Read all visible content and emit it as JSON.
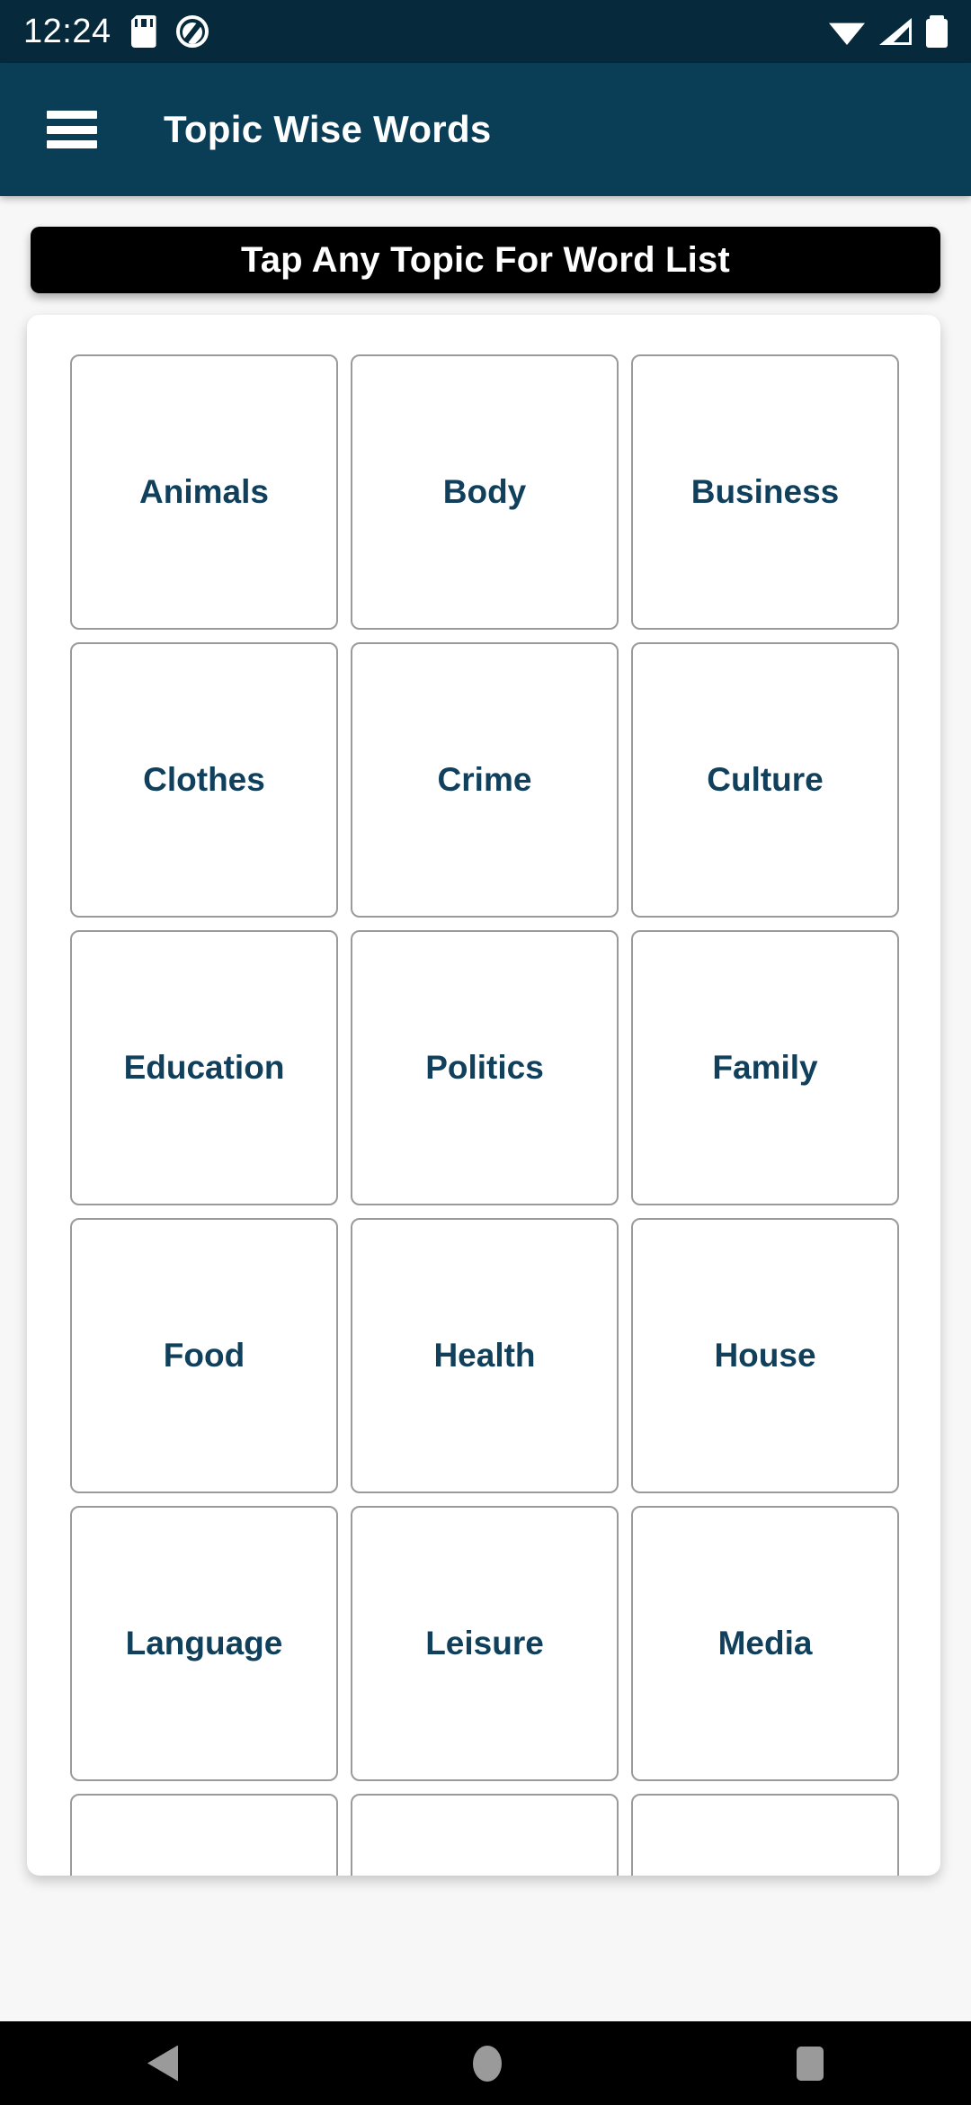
{
  "status_bar": {
    "time": "12:24",
    "left_icons": [
      "sd-card-icon",
      "do-not-disturb-icon"
    ],
    "right_icons": [
      "wifi-icon",
      "cellular-signal-icon",
      "battery-icon"
    ],
    "background_color": "#06293c"
  },
  "app_bar": {
    "menu_icon": "hamburger-menu-icon",
    "title": "Topic Wise Words",
    "background_color": "#0a3d56",
    "title_color": "#ffffff"
  },
  "banner": {
    "text": "Tap Any Topic For Word List",
    "background_color": "#000000",
    "text_color": "#ffffff"
  },
  "topic_grid": {
    "columns": 3,
    "card_border_color": "#9a9a9a",
    "label_color": "#11405c",
    "topics": [
      "Animals",
      "Body",
      "Business",
      "Clothes",
      "Crime",
      "Culture",
      "Education",
      "Politics",
      "Family",
      "Food",
      "Health",
      "House",
      "Language",
      "Leisure",
      "Media",
      "",
      "",
      ""
    ]
  },
  "nav_bar": {
    "background_color": "#000000",
    "icon_color": "#9a9a9a",
    "buttons": [
      {
        "name": "back-button"
      },
      {
        "name": "home-button"
      },
      {
        "name": "recents-button"
      }
    ]
  }
}
